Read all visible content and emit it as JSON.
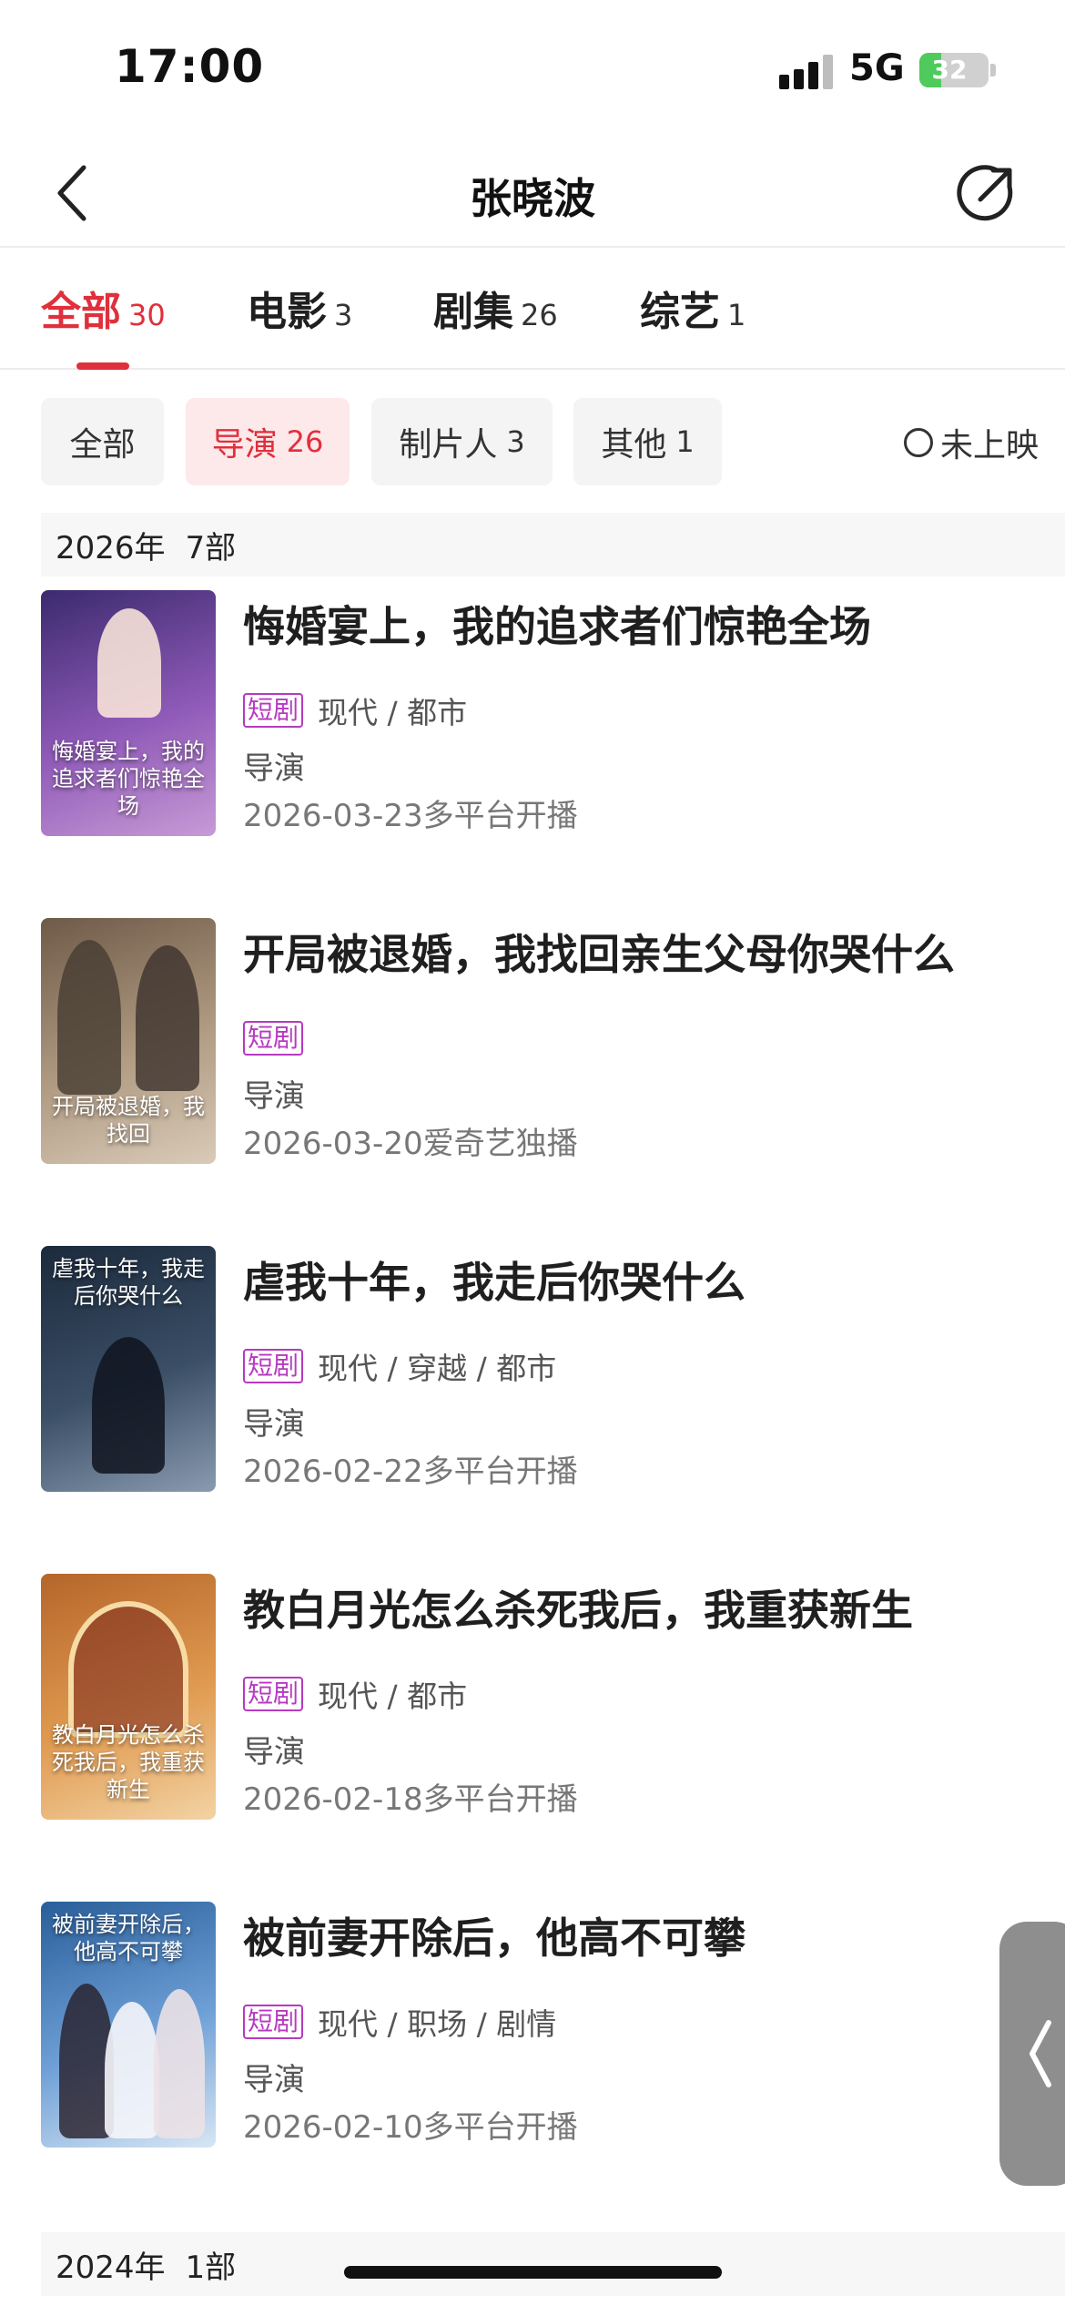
{
  "status_bar": {
    "time": "17:00",
    "network": "5G",
    "battery": "32",
    "battery_level": 0.32
  },
  "header": {
    "title": "张晓波",
    "back_icon": "chevron-left-icon",
    "share_icon": "share-icon"
  },
  "tabs": [
    {
      "label": "全部",
      "count": "30",
      "active": true
    },
    {
      "label": "电影",
      "count": "3",
      "active": false
    },
    {
      "label": "剧集",
      "count": "26",
      "active": false
    },
    {
      "label": "综艺",
      "count": "1",
      "active": false
    }
  ],
  "filters": [
    {
      "label": "全部",
      "count": "",
      "active": false
    },
    {
      "label": "导演",
      "count": "26",
      "active": true
    },
    {
      "label": "制片人",
      "count": "3",
      "active": false
    },
    {
      "label": "其他",
      "count": "1",
      "active": false
    }
  ],
  "unreleased_toggle": {
    "label": "未上映",
    "checked": false
  },
  "groups": [
    {
      "year": "2026年",
      "count": "7部"
    },
    {
      "year": "2024年",
      "count": "1部"
    }
  ],
  "items": [
    {
      "title": "悔婚宴上，我的追求者们惊艳全场",
      "tag": "短剧",
      "genres": "现代 / 都市",
      "role": "导演",
      "release": "2026-03-23多平台开播",
      "poster_text": "悔婚宴上，我的追求者们惊艳全场",
      "colors": [
        "#3b2a6e",
        "#8f5ab8",
        "#c89ad6"
      ]
    },
    {
      "title": "开局被退婚，我找回亲生父母你哭什么",
      "tag": "短剧",
      "genres": "",
      "role": "导演",
      "release": "2026-03-20爱奇艺独播",
      "poster_text": "开局被退婚，我找回",
      "colors": [
        "#6e5a48",
        "#b09a82",
        "#d9cbb8"
      ]
    },
    {
      "title": "虐我十年，我走后你哭什么",
      "tag": "短剧",
      "genres": "现代 / 穿越 / 都市",
      "role": "导演",
      "release": "2026-02-22多平台开播",
      "poster_text": "虐我十年，我走后你哭什么",
      "colors": [
        "#1c2a3c",
        "#3a4e66",
        "#8a9bb0"
      ]
    },
    {
      "title": "教白月光怎么杀死我后，我重获新生",
      "tag": "短剧",
      "genres": "现代 / 都市",
      "role": "导演",
      "release": "2026-02-18多平台开播",
      "poster_text": "教白月光怎么杀死我后，我重获新生",
      "colors": [
        "#b5652a",
        "#e09a50",
        "#f3d3a4"
      ]
    },
    {
      "title": "被前妻开除后，他高不可攀",
      "tag": "短剧",
      "genres": "现代 / 职场 / 剧情",
      "role": "导演",
      "release": "2026-02-10多平台开播",
      "poster_text": "被前妻开除后，他高不可攀",
      "colors": [
        "#2a5e9a",
        "#6ea0d6",
        "#d8e6f4"
      ]
    }
  ],
  "side_tab_icon": "chevron-left-icon"
}
